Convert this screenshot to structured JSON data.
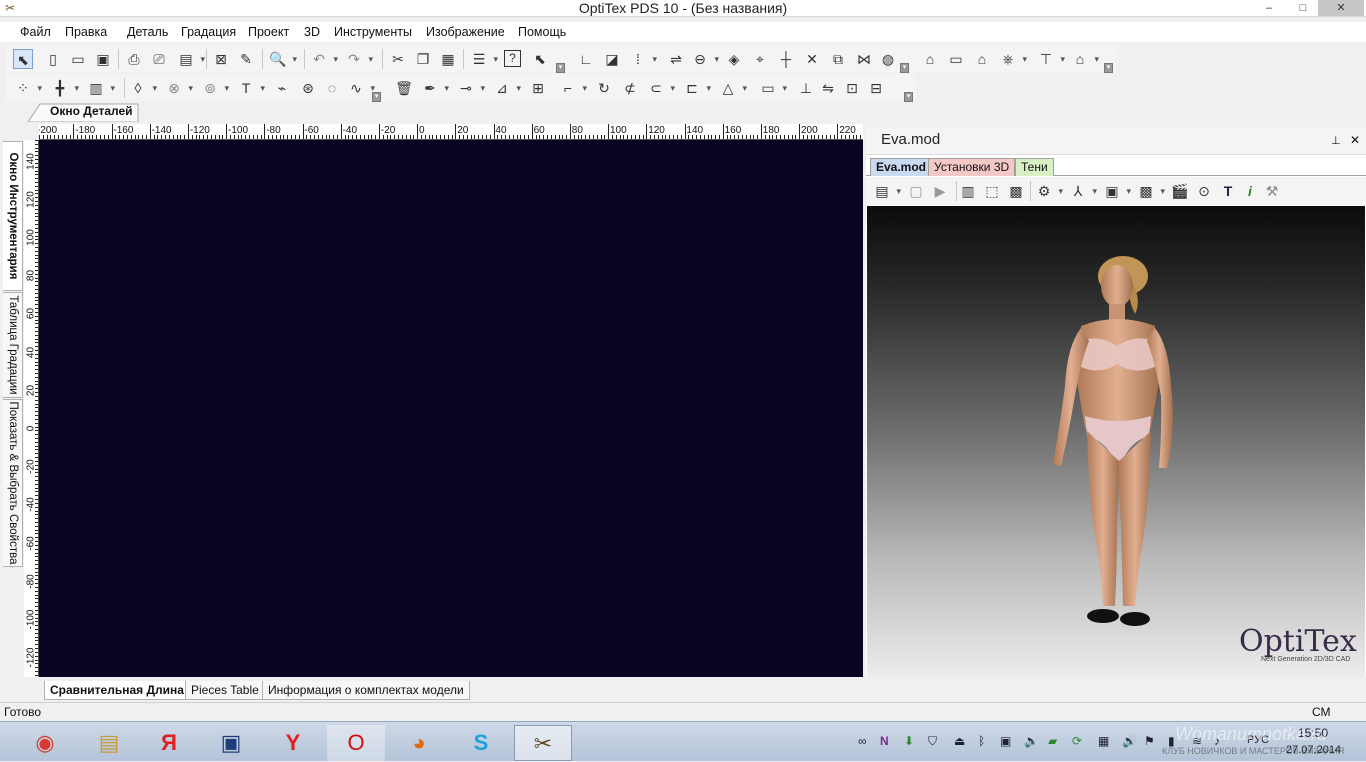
{
  "window": {
    "title": "OptiTex PDS 10 - (Без названия)",
    "minimize": "–",
    "maximize": "□",
    "close": "✕"
  },
  "menu": [
    "Файл",
    "Правка",
    "Деталь",
    "Градация",
    "Проект",
    "3D",
    "Инструменты",
    "Изображение",
    "Помощь"
  ],
  "toolbar1_icons": [
    "pointer-icon",
    "new-file-icon",
    "open-folder-icon",
    "save-icon",
    "print-icon",
    "plot-icon",
    "print-setup-icon",
    "delete-piece-icon",
    "measure-icon",
    "zoom-icon",
    "undo-icon",
    "redo-icon",
    "cut-icon",
    "copy-icon",
    "paste-icon",
    "properties-icon",
    "help-icon",
    "context-help-icon",
    "axis-icon",
    "rotate-piece-icon",
    "grade-rules-icon",
    "mirror-icon",
    "swap-icon",
    "add-point-icon",
    "sew-icon",
    "align-icon",
    "dart-icon",
    "pleat-icon",
    "notch-icon",
    "circle-icon",
    "piece-tool-icon",
    "ruler-icon",
    "hanger-icon",
    "marker-icon",
    "text-tool-icon",
    "block-icon"
  ],
  "toolbar2_icons": [
    "point-icon",
    "grade-point-icon",
    "dart-tool-icon",
    "fold-icon",
    "button-icon",
    "buttonhole-icon",
    "text-icon",
    "walk-icon",
    "seam-icon",
    "curve-tool-icon",
    "smooth-icon",
    "trash-icon",
    "pen-icon",
    "node-icon",
    "offset-icon",
    "split-icon",
    "rotate-icon",
    "refresh-icon",
    "layer-icon",
    "link-icon",
    "align-left-icon",
    "triangle-icon",
    "page-icon",
    "anchor-icon",
    "layout-icon",
    "export-icon",
    "report-icon"
  ],
  "tabs": {
    "top": "Окно Деталей",
    "vertical": [
      "Окно Инструментария",
      "Таблица Градации",
      "Показать & Выбрать Свойства"
    ],
    "bottom": [
      "Сравнительная Длина",
      "Pieces Table",
      "Информация о комплектах модели"
    ]
  },
  "ruler": {
    "top_labels": [
      "-200",
      "-180",
      "-160",
      "-140",
      "-120",
      "-100",
      "-80",
      "-60",
      "-40",
      "-20",
      "0",
      "20",
      "40",
      "60",
      "80",
      "100",
      "120",
      "140",
      "160",
      "180",
      "200",
      "220"
    ],
    "left_labels": [
      "140",
      "120",
      "100",
      "80",
      "60",
      "40",
      "20",
      "0",
      "-20",
      "-40",
      "-60",
      "-80",
      "-100",
      "-120"
    ]
  },
  "panel": {
    "title": "Eva.mod",
    "pin": "⊥",
    "close": "✕",
    "tabs": [
      {
        "label": "Eva.mod",
        "color": "#c9d9f2"
      },
      {
        "label": "Установки 3D",
        "color": "#f5c8c8"
      },
      {
        "label": "Тени",
        "color": "#d9efc4"
      }
    ],
    "toolbar_icons": [
      "model-icon",
      "texture-icon",
      "play-icon",
      "drape-icon",
      "fit-icon",
      "grid-icon",
      "tension-icon",
      "axes-icon",
      "view-icon",
      "camera-icon",
      "clapper-icon",
      "render-icon",
      "text-icon",
      "info-icon",
      "settings-icon"
    ],
    "brand": "OptiTex",
    "brand_tagline": "Next Generation 2D/3D CAD"
  },
  "status": {
    "text": "Готово",
    "units": "СМ"
  },
  "taskbar": {
    "apps": [
      "chrome-icon",
      "explorer-icon",
      "yandex-icon",
      "save-app-icon",
      "yandex-browser-icon",
      "opera-icon",
      "firefox-icon",
      "skype-icon",
      "optitex-icon"
    ],
    "lang": "РУС",
    "time": "15:50",
    "date": "27.07.2014"
  },
  "watermark": {
    "line1": "Womanumnotka.ru",
    "line2": "КЛУБ НОВИЧКОВ И МАСТЕРОВ ВЯЗАНИЯ"
  }
}
